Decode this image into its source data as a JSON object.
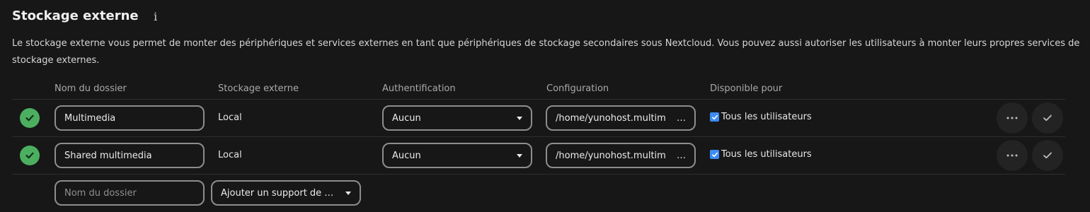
{
  "section": {
    "title": "Stockage externe",
    "info_icon": "info-icon",
    "description": "Le stockage externe vous permet de monter des périphériques et services externes en tant que périphériques de stockage secondaires sous Nextcloud. Vous pouvez aussi autoriser les utilisateurs à monter leurs propres services de stockage externes."
  },
  "table": {
    "columns": [
      "Nom du dossier",
      "Stockage externe",
      "Authentification",
      "Configuration",
      "Disponible pour"
    ],
    "rows": [
      {
        "status": "check-circle-icon",
        "folder_name": "Multimedia",
        "backend": "Local",
        "auth": "Aucun",
        "config": "/home/yunohost.multim",
        "config_overflow": "…",
        "available_for": "Tous les utilisateurs",
        "available_checked": true
      },
      {
        "status": "check-circle-icon",
        "folder_name": "Shared multimedia",
        "backend": "Local",
        "auth": "Aucun",
        "config": "/home/yunohost.multim",
        "config_overflow": "…",
        "available_for": "Tous les utilisateurs",
        "available_checked": true
      }
    ],
    "new_row": {
      "folder_placeholder": "Nom du dossier",
      "add_backend_label": "Ajouter un support de …"
    }
  },
  "colors": {
    "background": "#171717",
    "success": "#4caf60",
    "checkbox": "#3d8bf5",
    "border": "#8d8d8d"
  }
}
